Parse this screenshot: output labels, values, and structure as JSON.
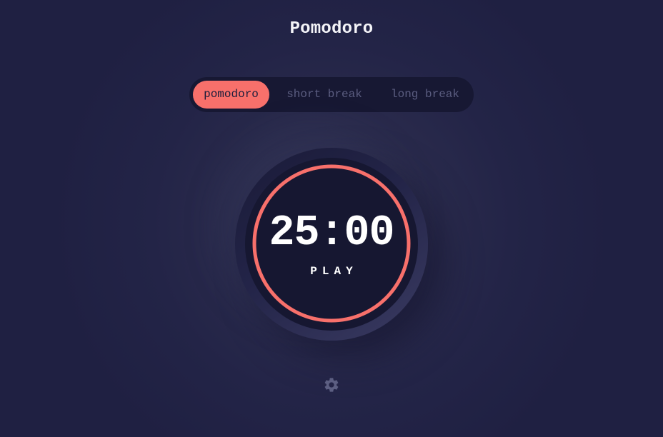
{
  "app": {
    "title": "Pomodoro"
  },
  "modes": {
    "items": [
      {
        "label": "pomodoro",
        "active": true
      },
      {
        "label": "short break",
        "active": false
      },
      {
        "label": "long break",
        "active": false
      }
    ]
  },
  "timer": {
    "time": "25:00",
    "action_label": "PLAY",
    "progress": 1.0
  },
  "icons": {
    "settings": "gear-icon"
  },
  "colors": {
    "accent": "#f8706b",
    "background": "#1f2042",
    "timer_face": "#161731",
    "tab_bar": "#171833",
    "inactive_text": "#5b5d80",
    "text": "#ffffff"
  }
}
